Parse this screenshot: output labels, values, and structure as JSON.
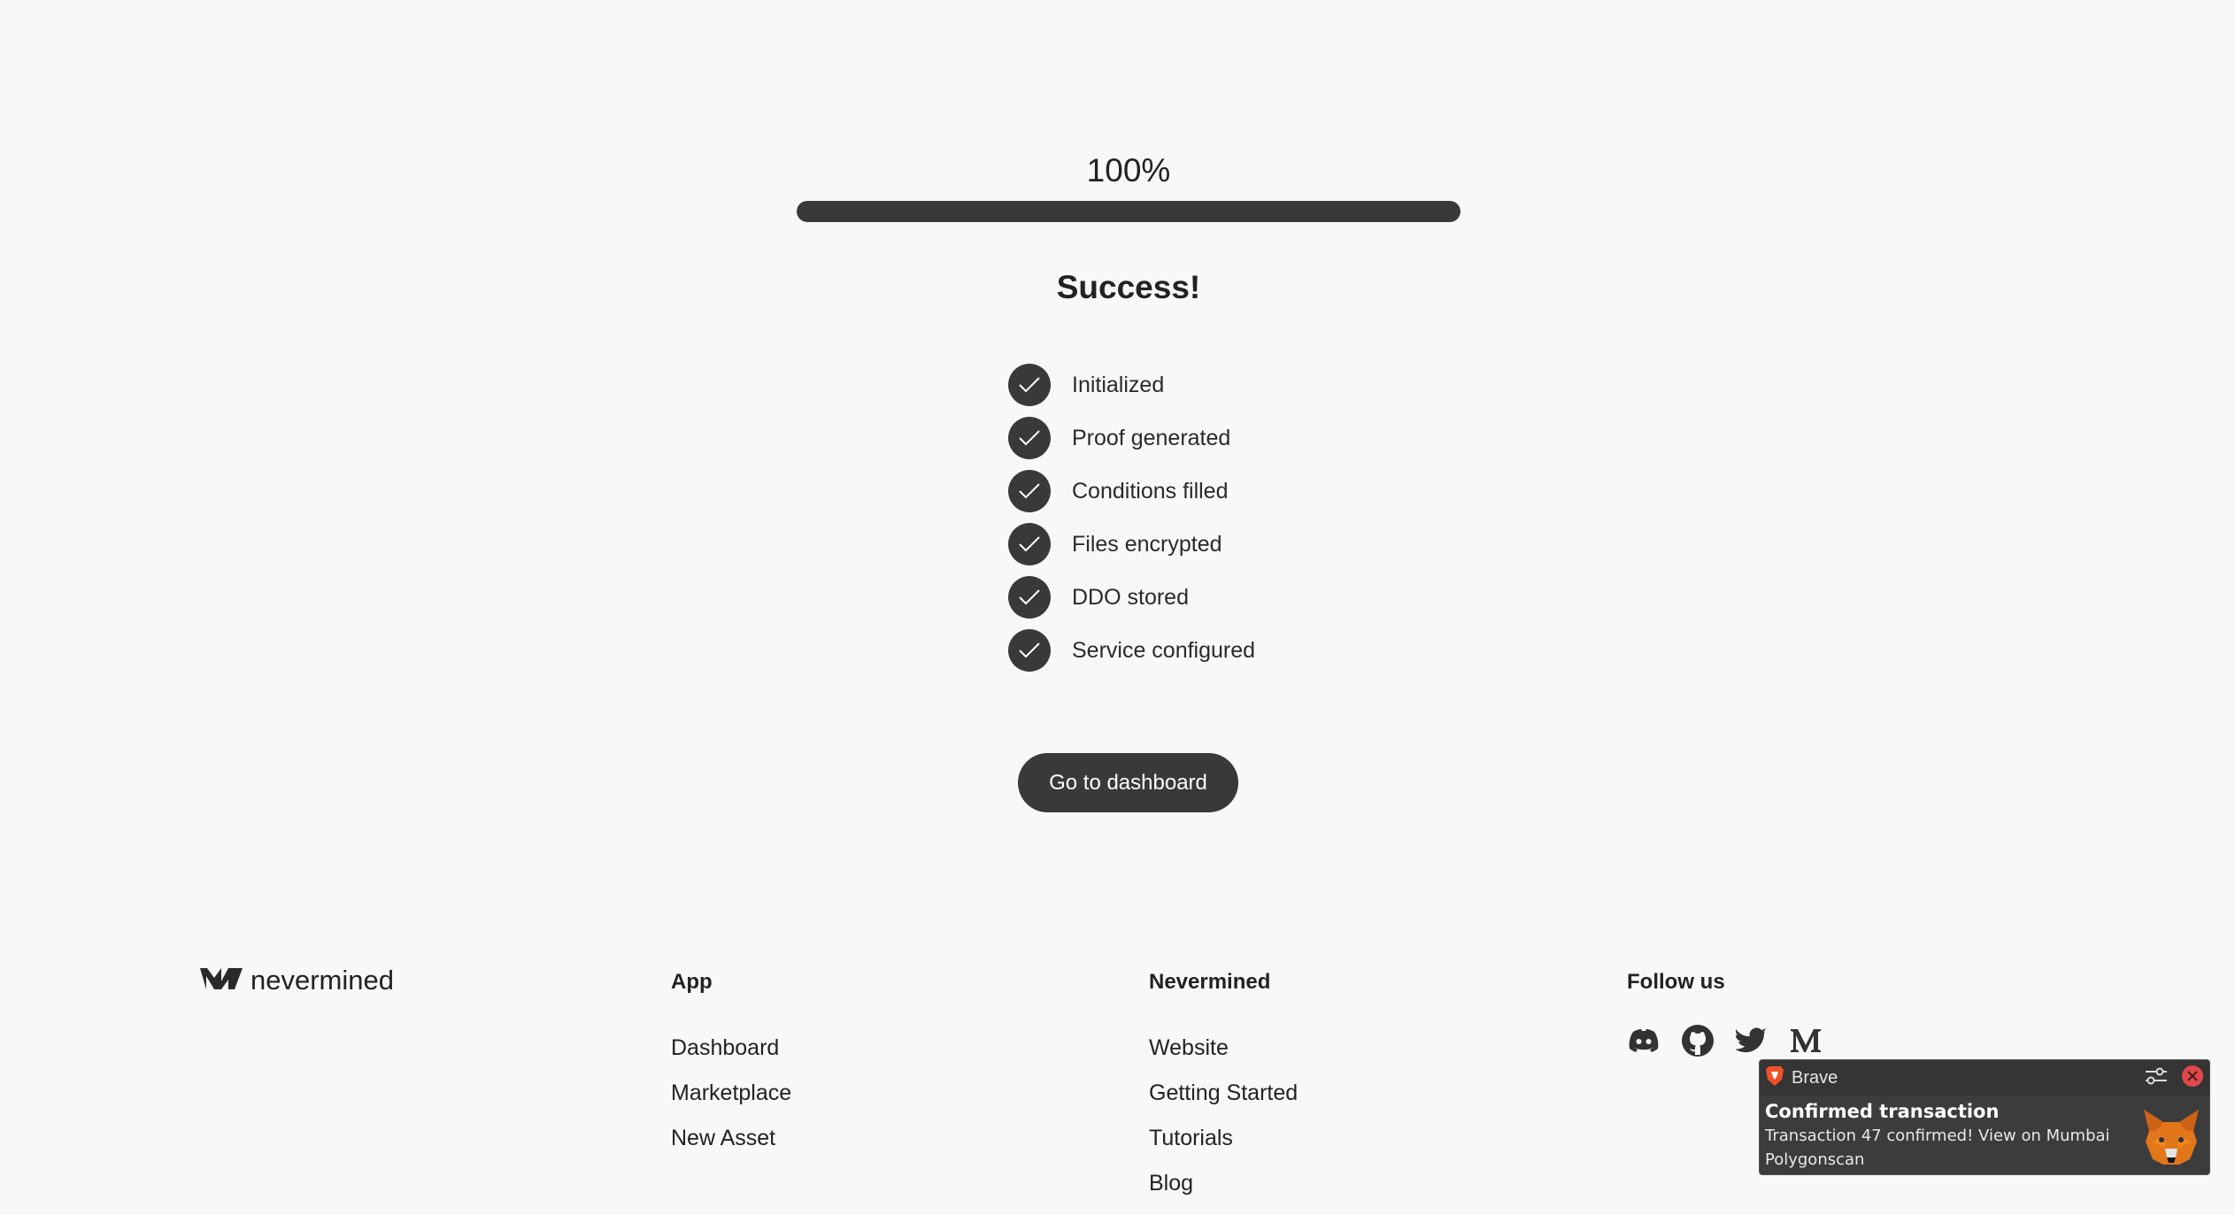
{
  "progress": {
    "value_label": "100%",
    "percent": 100,
    "track_color": "#d8d8d8",
    "fill_color": "#393939"
  },
  "status": {
    "title": "Success!"
  },
  "steps": [
    {
      "label": "Initialized",
      "done": true
    },
    {
      "label": "Proof generated",
      "done": true
    },
    {
      "label": "Conditions filled",
      "done": true
    },
    {
      "label": "Files encrypted",
      "done": true
    },
    {
      "label": "DDO stored",
      "done": true
    },
    {
      "label": "Service configured",
      "done": true
    }
  ],
  "actions": {
    "dashboard_label": "Go to dashboard"
  },
  "footer": {
    "brand": {
      "name": "nevermined",
      "icon": "nevermined-logo-icon"
    },
    "app": {
      "title": "App",
      "links": [
        "Dashboard",
        "Marketplace",
        "New Asset"
      ]
    },
    "nevermined": {
      "title": "Nevermined",
      "links": [
        "Website",
        "Getting Started",
        "Tutorials",
        "Blog"
      ]
    },
    "follow": {
      "title": "Follow us",
      "icons": [
        "discord-icon",
        "github-icon",
        "twitter-icon",
        "medium-icon"
      ]
    }
  },
  "notification": {
    "app_name": "Brave",
    "title": "Confirmed transaction",
    "text": "Transaction 47 confirmed! View on Mumbai Polygonscan",
    "icons": [
      "brave-icon",
      "settings-icon",
      "close-icon",
      "metamask-fox-icon"
    ],
    "close_color": "#e0484b"
  },
  "colors": {
    "background": "#f8f8f8",
    "accent": "#393939"
  }
}
